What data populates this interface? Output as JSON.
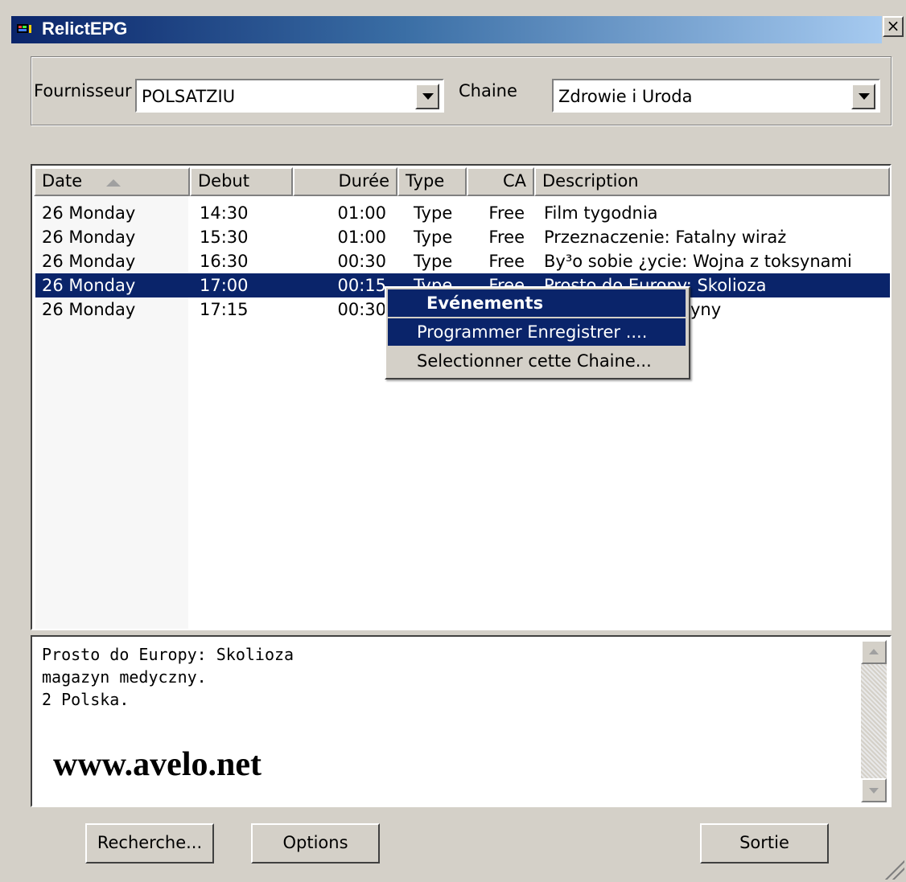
{
  "window": {
    "title": "RelictEPG",
    "close_label": "×"
  },
  "selector": {
    "provider_label": "Fournisseur",
    "provider_value": "POLSATZIU",
    "channel_label": "Chaine",
    "channel_value": "Zdrowie i Uroda"
  },
  "list": {
    "columns": [
      "Date",
      "Debut",
      "Durée",
      "Type",
      "CA",
      "Description"
    ],
    "rows": [
      {
        "date": "26 Monday",
        "debut": "14:30",
        "duree": "01:00",
        "type": "Type",
        "ca": "Free",
        "desc": "Film tygodnia"
      },
      {
        "date": "26 Monday",
        "debut": "15:30",
        "duree": "01:00",
        "type": "Type",
        "ca": "Free",
        "desc": "Przeznaczenie: Fatalny wiraż"
      },
      {
        "date": "26 Monday",
        "debut": "16:30",
        "duree": "00:30",
        "type": "Type",
        "ca": "Free",
        "desc": "By³o sobie ¿ycie: Wojna z toksynami"
      },
      {
        "date": "26 Monday",
        "debut": "17:00",
        "duree": "00:15",
        "type": "Type",
        "ca": "Free",
        "desc": "Prosto do Europy: Skolioza"
      },
      {
        "date": "26 Monday",
        "debut": "17:15",
        "duree": "00:30",
        "type": "",
        "ca": "",
        "desc": "yny"
      }
    ]
  },
  "context_menu": {
    "title": "Evénements",
    "items": [
      "Programmer Enregistrer ....",
      "Selectionner cette Chaine..."
    ]
  },
  "details": {
    "lines": [
      "Prosto do Europy: Skolioza",
      "magazyn medyczny.",
      "2 Polska."
    ],
    "watermark": "www.avelo.net"
  },
  "buttons": {
    "search": "Recherche...",
    "options": "Options",
    "exit": "Sortie"
  },
  "colors": {
    "selection": "#0a246a",
    "face": "#d4d0c8"
  }
}
